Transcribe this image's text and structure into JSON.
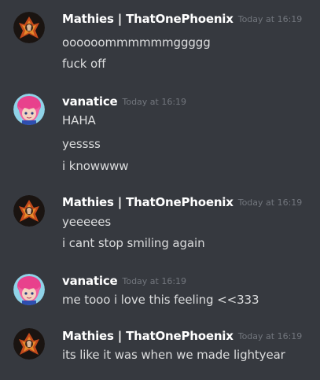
{
  "messages": [
    {
      "author": "Mathies | ThatOnePhoenix",
      "avatar": "phoenix-avatar",
      "timestamp": "Today at 16:19",
      "lines": [
        "oooooommmmmmggggg",
        "fuck off"
      ]
    },
    {
      "author": "vanatice",
      "avatar": "pink-hair-avatar",
      "timestamp": "Today at 16:19",
      "lines": [
        "HAHA",
        "yessss",
        "i knowwww"
      ]
    },
    {
      "author": "Mathies | ThatOnePhoenix",
      "avatar": "phoenix-avatar",
      "timestamp": "Today at 16:19",
      "lines": [
        "yeeeees",
        "i cant stop smiling again"
      ]
    },
    {
      "author": "vanatice",
      "avatar": "pink-hair-avatar",
      "timestamp": "Today at 16:19",
      "lines": [
        "me tooo i love this feeling <<333"
      ]
    },
    {
      "author": "Mathies | ThatOnePhoenix",
      "avatar": "phoenix-avatar",
      "timestamp": "Today at 16:19",
      "lines": [
        "its like it was when we made lightyear"
      ]
    }
  ],
  "colors": {
    "background": "#36393f",
    "username": "#ffffff",
    "text": "#dcddde",
    "timestamp": "#72767d"
  }
}
